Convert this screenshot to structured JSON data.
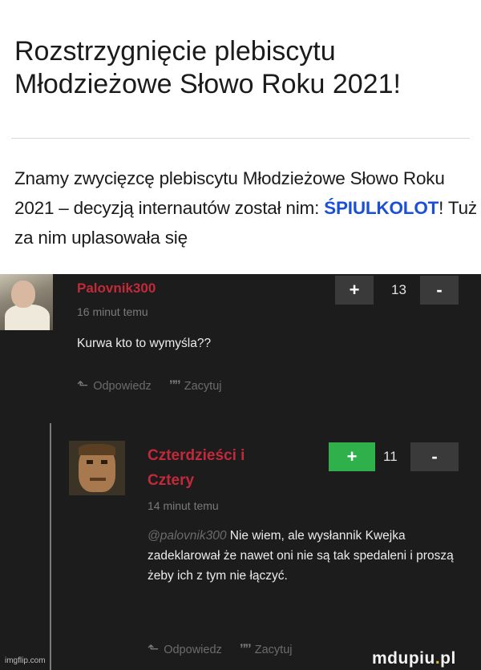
{
  "header": {
    "title_line1": "Rozstrzygnięcie plebiscytu",
    "title_line2": "Młodzieżowe Słowo Roku 2021!"
  },
  "article": {
    "text_before": "Znamy zwycięzcę plebiscytu Młodzieżowe Słowo Roku 2021 – decyzją internautów został nim: ",
    "keyword": "ŚPIULKOLOT",
    "text_after": "! Tuż za nim uplasowała się"
  },
  "comments": [
    {
      "username": "Palovnik300",
      "time": "16 minut temu",
      "text": "Kurwa kto to wymyśla??",
      "upvote_label": "+",
      "score": "13",
      "downvote_label": "-",
      "reply_label": "Odpowiedz",
      "quote_label": "Zacytuj",
      "reply_icon": "reply-arrow-icon",
      "quote_icon": "quote-icon"
    },
    {
      "username_line1": "Czterdzieści i",
      "username_line2": "Cztery",
      "time": "14 minut temu",
      "mention": "@palovnik300",
      "text": " Nie wiem, ale wysłannik Kwejka zadeklarował że nawet oni nie są tak spedaleni i proszą żeby ich z tym nie łączyć.",
      "upvote_label": "+",
      "score": "11",
      "downvote_label": "-",
      "reply_label": "Odpowiedz",
      "quote_label": "Zacytuj",
      "upvote_color": "#2fb04a"
    }
  ],
  "watermarks": {
    "left": "imgflip.com",
    "right_main": "mdupiu",
    "right_dot": ".",
    "right_tail": "pl"
  },
  "colors": {
    "username": "#c22a3a",
    "keyword": "#1a4fd8",
    "dark_bg": "#1c1c1c"
  }
}
